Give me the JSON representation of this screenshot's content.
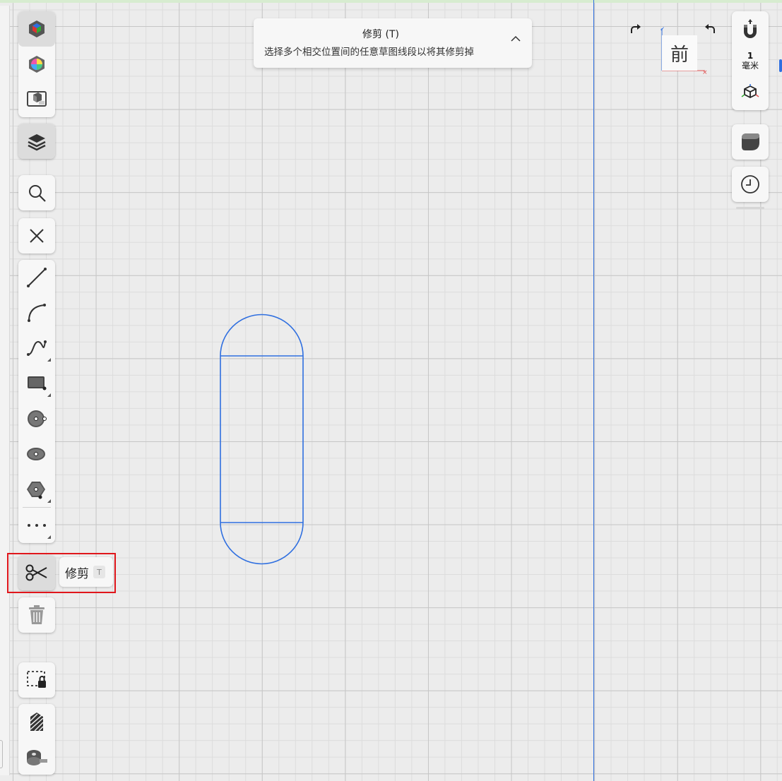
{
  "info_card": {
    "title": "修剪 (T)",
    "description": "选择多个相交位置间的任意草图线段以将其修剪掉"
  },
  "tooltip": {
    "name": "修剪",
    "shortcut": "T"
  },
  "view_cube": {
    "face_label": "前"
  },
  "units": {
    "value": "1",
    "name": "毫米"
  },
  "colors": {
    "sketch_line": "#2f6fe0",
    "highlight": "#e0161b",
    "panel_bg": "#f7f7f7"
  },
  "left_tools": [
    "display-mode-icon",
    "appearance-icon",
    "section-view-icon",
    "layers-icon",
    "search-icon",
    "close-icon",
    "line-icon",
    "arc-icon",
    "spline-icon",
    "rectangle-icon",
    "circle-icon",
    "ellipse-icon",
    "polygon-icon",
    "more-icon",
    "trim-scissors-icon",
    "delete-icon",
    "lock-selection-icon",
    "hatch-icon",
    "measure-tape-icon"
  ],
  "right_tools": [
    "snap-magnet-icon",
    "axis-icon",
    "shaded-view-icon",
    "history-clock-icon"
  ]
}
